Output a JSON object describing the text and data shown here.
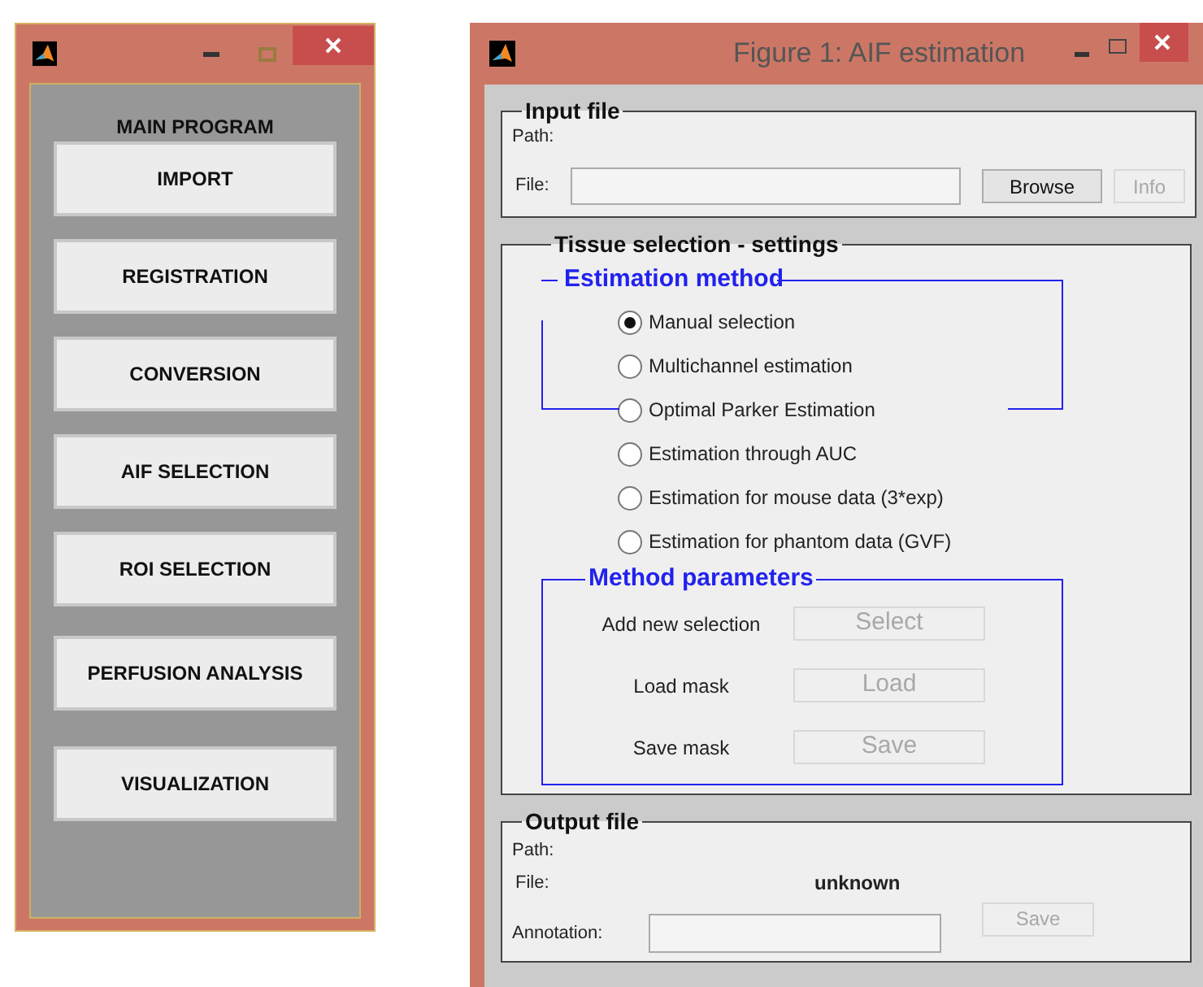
{
  "main_window": {
    "heading": "MAIN PROGRAM",
    "buttons": [
      {
        "label": "IMPORT"
      },
      {
        "label": "REGISTRATION"
      },
      {
        "label": "CONVERSION"
      },
      {
        "label": "AIF SELECTION"
      },
      {
        "label": "ROI SELECTION"
      },
      {
        "label": "PERFUSION ANALYSIS"
      },
      {
        "label": "VISUALIZATION"
      }
    ]
  },
  "figure_window": {
    "title": "Figure 1: AIF estimation",
    "input_file": {
      "title": "Input file",
      "path_label": "Path:",
      "file_label": "File:",
      "browse": {
        "label": "Browse",
        "disabled": false
      },
      "info": {
        "label": "Info",
        "disabled": true
      }
    },
    "tissue_selection": {
      "title": "Tissue selection - settings",
      "estimation_method": {
        "title": "Estimation method",
        "options": [
          {
            "label": "Manual selection",
            "selected": true
          },
          {
            "label": "Multichannel estimation",
            "selected": false
          },
          {
            "label": "Optimal Parker Estimation",
            "selected": false
          },
          {
            "label": "Estimation through AUC",
            "selected": false
          },
          {
            "label": "Estimation for mouse data (3*exp)",
            "selected": false
          },
          {
            "label": "Estimation for phantom data (GVF)",
            "selected": false
          }
        ]
      },
      "method_parameters": {
        "title": "Method parameters",
        "rows": [
          {
            "label": "Add new selection",
            "button": "Select",
            "disabled": true
          },
          {
            "label": "Load mask",
            "button": "Load",
            "disabled": true
          },
          {
            "label": "Save mask",
            "button": "Save",
            "disabled": true
          }
        ]
      }
    },
    "output_file": {
      "title": "Output file",
      "path_label": "Path:",
      "file_label": "File:",
      "file_value": "unknown",
      "annotation_label": "Annotation:",
      "save": {
        "label": "Save",
        "disabled": true
      }
    }
  }
}
